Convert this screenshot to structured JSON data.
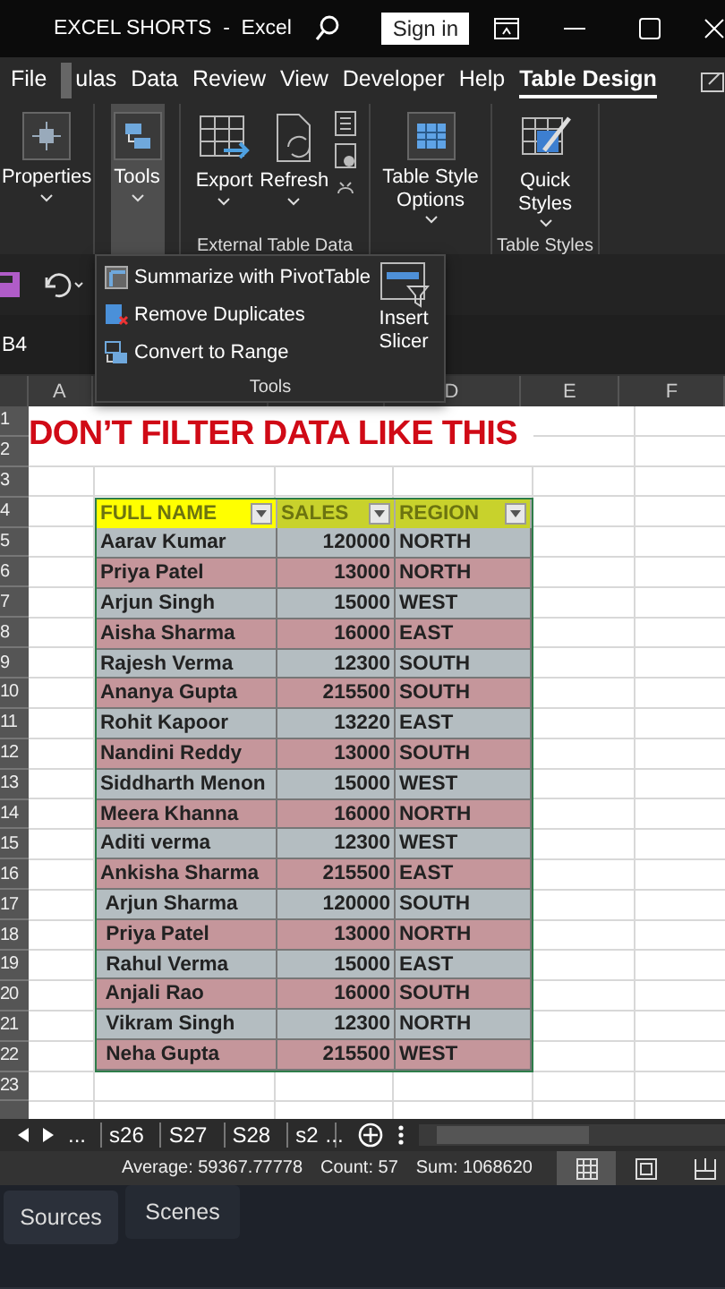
{
  "window": {
    "title": "EXCEL SHORTS  -  Excel",
    "sign_in": "Sign in"
  },
  "ribbon_tabs": [
    {
      "label": "File",
      "selected": false
    },
    {
      "label": "ulas",
      "selected": false
    },
    {
      "label": "Data",
      "selected": false
    },
    {
      "label": "Review",
      "selected": false
    },
    {
      "label": "View",
      "selected": false
    },
    {
      "label": "Developer",
      "selected": false
    },
    {
      "label": "Help",
      "selected": false
    },
    {
      "label": "Table Design",
      "selected": true
    }
  ],
  "ribbon_groups": [
    {
      "commands": [
        {
          "label": "Properties",
          "selected": false
        }
      ]
    },
    {
      "commands": [
        {
          "label": "Tools",
          "selected": true
        }
      ]
    },
    {
      "label": "External Table Data",
      "commands": [
        {
          "label": "Export",
          "selected": false
        },
        {
          "label": "Refresh",
          "selected": false
        }
      ]
    },
    {
      "commands": [
        {
          "label": "Table Style Options",
          "selected": false
        }
      ]
    },
    {
      "label": "Table Styles",
      "commands": [
        {
          "label": "Quick Styles",
          "selected": false
        }
      ]
    }
  ],
  "tools_menu": {
    "items": [
      {
        "label": "Summarize with PivotTable"
      },
      {
        "label": "Remove Duplicates"
      },
      {
        "label": "Convert to Range"
      }
    ],
    "big_button": "Insert Slicer",
    "group_label": "Tools"
  },
  "name_box": "B4",
  "sheet": {
    "column_headers": [
      "A",
      "D",
      "E",
      "F"
    ],
    "row_headers": [
      "1",
      "2",
      "3",
      "4",
      "5",
      "6",
      "7",
      "8",
      "9",
      "10",
      "11",
      "12",
      "13",
      "14",
      "15",
      "16",
      "17",
      "18",
      "19",
      "20",
      "21",
      "22",
      "23"
    ],
    "heading": "DON’T FILTER DATA LIKE THIS",
    "table": {
      "columns": [
        {
          "label": "FULL NAME",
          "selected": true
        },
        {
          "label": "SALES",
          "selected": false
        },
        {
          "label": "REGION",
          "selected": false
        }
      ],
      "rows": [
        [
          "Aarav Kumar",
          "120000",
          "NORTH"
        ],
        [
          "Priya Patel",
          "13000",
          "NORTH"
        ],
        [
          "Arjun Singh",
          "15000",
          "WEST"
        ],
        [
          "Aisha Sharma",
          "16000",
          "EAST"
        ],
        [
          "Rajesh Verma",
          "12300",
          "SOUTH"
        ],
        [
          "Ananya Gupta",
          "215500",
          "SOUTH"
        ],
        [
          "Rohit Kapoor",
          "13220",
          "EAST"
        ],
        [
          "Nandini Reddy",
          "13000",
          "SOUTH"
        ],
        [
          "Siddharth Menon",
          "15000",
          "WEST"
        ],
        [
          "Meera Khanna",
          "16000",
          "NORTH"
        ],
        [
          "Aditi verma",
          "12300",
          "WEST"
        ],
        [
          "Ankisha Sharma",
          "215500",
          "EAST"
        ],
        [
          " Arjun Sharma",
          "120000",
          "SOUTH"
        ],
        [
          " Priya Patel",
          "13000",
          "NORTH"
        ],
        [
          " Rahul Verma",
          "15000",
          "EAST"
        ],
        [
          " Anjali Rao",
          "16000",
          "SOUTH"
        ],
        [
          " Vikram Singh",
          "12300",
          "NORTH"
        ],
        [
          " Neha Gupta",
          "215500",
          "WEST"
        ]
      ]
    }
  },
  "sheet_tabs": {
    "more": "...",
    "tabs": [
      {
        "label": "s26",
        "selected": false
      },
      {
        "label": "S27",
        "selected": false
      },
      {
        "label": "S28",
        "selected": false
      },
      {
        "label": "s2",
        "selected": false
      }
    ],
    "overflow": "..."
  },
  "status_bar": {
    "stats": [
      "Average: 59367.77778",
      "Count: 57",
      "Sum: 1068620"
    ],
    "views": [
      {
        "kind": "normal",
        "selected": true
      },
      {
        "kind": "page_layout",
        "selected": false
      },
      {
        "kind": "page_break",
        "selected": false
      }
    ]
  },
  "dock_tabs": [
    {
      "label": "Sources",
      "selected": true
    },
    {
      "label": "Scenes",
      "selected": false
    }
  ]
}
